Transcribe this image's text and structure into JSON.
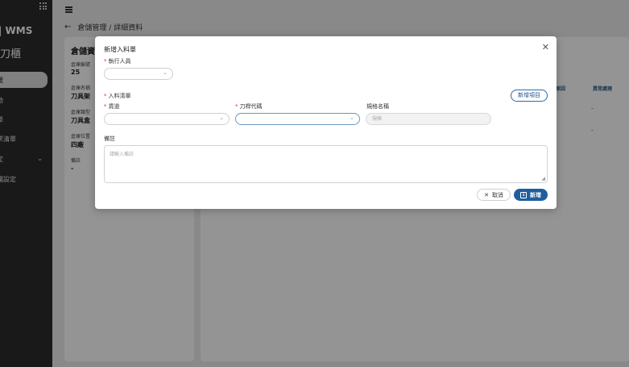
{
  "sidebar": {
    "brand": "| WMS",
    "app_name": "慧刀櫃",
    "items": [
      {
        "label": "覽",
        "active": true
      },
      {
        "label": "動",
        "active": false
      },
      {
        "label": "單",
        "active": false
      },
      {
        "label": "求清單",
        "active": false
      },
      {
        "label": "定",
        "active": false
      },
      {
        "label": "櫃設定",
        "active": false
      }
    ]
  },
  "breadcrumb": "倉儲管理 / 詳細資料",
  "detail": {
    "title": "倉儲資",
    "fields": [
      {
        "label": "倉庫編號",
        "value": "25"
      },
      {
        "label": "倉庫名稱",
        "value": "刀具架"
      },
      {
        "label": "倉庫類型",
        "value": "刀具盒"
      },
      {
        "label": "倉庫位置",
        "value": "四廠"
      },
      {
        "label": "備註",
        "value": "-"
      }
    ]
  },
  "table": {
    "headers": [
      "原因",
      "異常處理"
    ],
    "rows": [
      [
        "-"
      ],
      [
        "-"
      ]
    ]
  },
  "modal": {
    "title": "新增入料單",
    "executor_label": "執行人員",
    "list_label": "入料清單",
    "add_item_label": "新增項目",
    "slot_label": "貨道",
    "tool_code_label": "刀桿代碼",
    "spec_label": "規格名稱",
    "spec_placeholder": "規格",
    "remark_label": "備註",
    "remark_placeholder": "請輸入備註",
    "cancel_label": "取消",
    "submit_label": "新增"
  }
}
